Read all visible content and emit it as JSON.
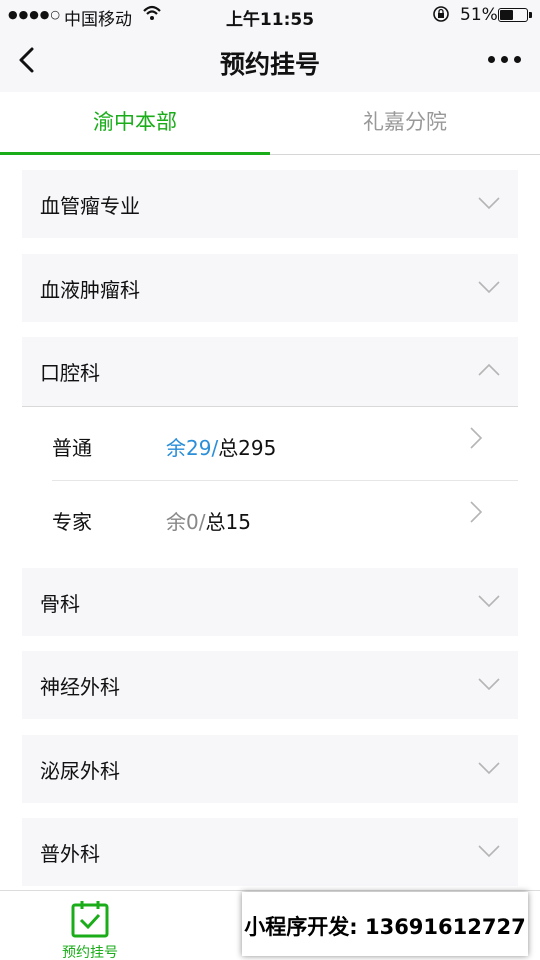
{
  "status_bar": {
    "signal": "●●●●○",
    "carrier": "中国移动",
    "time": "上午11:55",
    "battery_percent": "51%",
    "battery_level": 0.51
  },
  "nav": {
    "title": "预约挂号"
  },
  "tabs": [
    {
      "label": "渝中本部",
      "active": true
    },
    {
      "label": "礼嘉分院",
      "active": false
    }
  ],
  "departments": [
    {
      "label": "血管瘤专业",
      "expanded": false
    },
    {
      "label": "血液肿瘤科",
      "expanded": false
    },
    {
      "label": "口腔科",
      "expanded": true
    },
    {
      "label": "骨科",
      "expanded": false
    },
    {
      "label": "神经外科",
      "expanded": false
    },
    {
      "label": "泌尿外科",
      "expanded": false
    },
    {
      "label": "普外科",
      "expanded": false
    }
  ],
  "appointments": [
    {
      "type": "普通",
      "remaining": "余29/",
      "total": "总295",
      "available": true
    },
    {
      "type": "专家",
      "remaining": "余0/",
      "total": "总15",
      "available": false
    }
  ],
  "bottom_tab": {
    "label": "预约挂号"
  },
  "promo": {
    "text": "小程序开发: 13691612727"
  },
  "colors": {
    "accent": "#1aad19",
    "available": "#2a8ed8",
    "unavailable": "#888888"
  }
}
